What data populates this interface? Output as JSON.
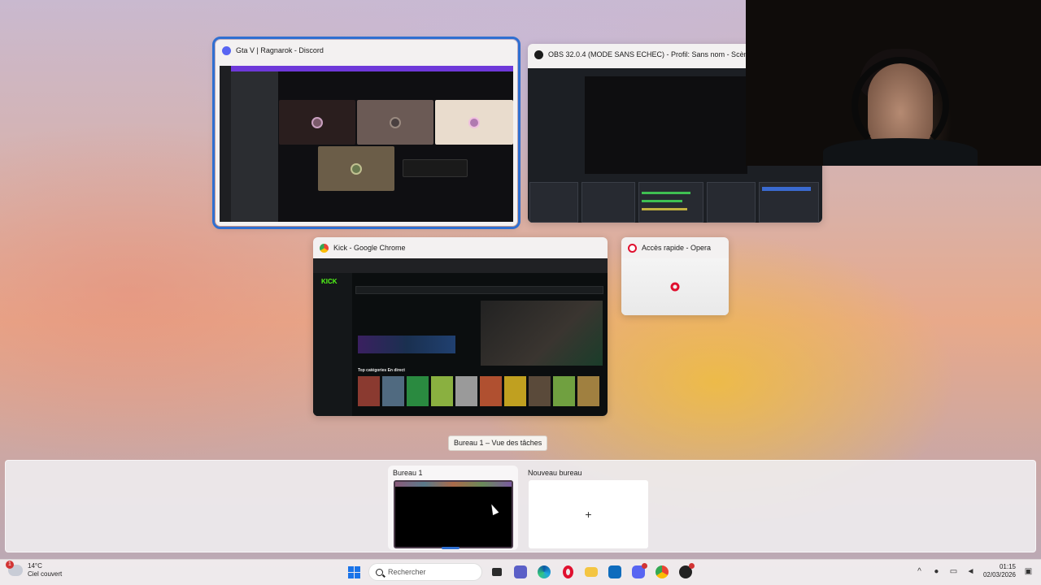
{
  "windows": {
    "discord": {
      "title": "Gta V | Ragnarok - Discord",
      "icon_color": "#5865f2",
      "icon": "discord-icon"
    },
    "obs": {
      "title": "OBS 32.0.4 (MODE SANS ECHEC) - Profil: Sans nom - Scènes: Sans nom",
      "icon_color": "#1b1b1b",
      "icon": "obs-icon"
    },
    "chrome": {
      "title": "Kick - Google Chrome",
      "icon": "chrome-icon",
      "page": {
        "logo": "KICK",
        "section": "Top catégories En direct"
      }
    },
    "opera": {
      "title": "Accès rapide - Opera",
      "icon": "opera-icon",
      "icon_color": "#e0102f"
    }
  },
  "tooltip": "Bureau 1 – Vue des tâches",
  "desktops": {
    "items": [
      {
        "label": "Bureau 1",
        "current": true
      },
      {
        "label": "Nouveau bureau",
        "plus": "+"
      }
    ]
  },
  "taskbar": {
    "weather": {
      "temp": "14°C",
      "condition": "Ciel couvert",
      "badge": "1"
    },
    "search_placeholder": "Rechercher",
    "apps": [
      "file-explorer-icon",
      "teams-icon",
      "edge-icon",
      "opera-icon",
      "folder-icon",
      "store-icon",
      "discord-icon",
      "chrome-icon",
      "obs-icon"
    ],
    "clock": {
      "time": "01:15",
      "date": "02/03/2026"
    }
  },
  "colors": {
    "accent": "#2f6fd1",
    "kick_green": "#53fc18",
    "discord_purple": "#6e38d9"
  }
}
